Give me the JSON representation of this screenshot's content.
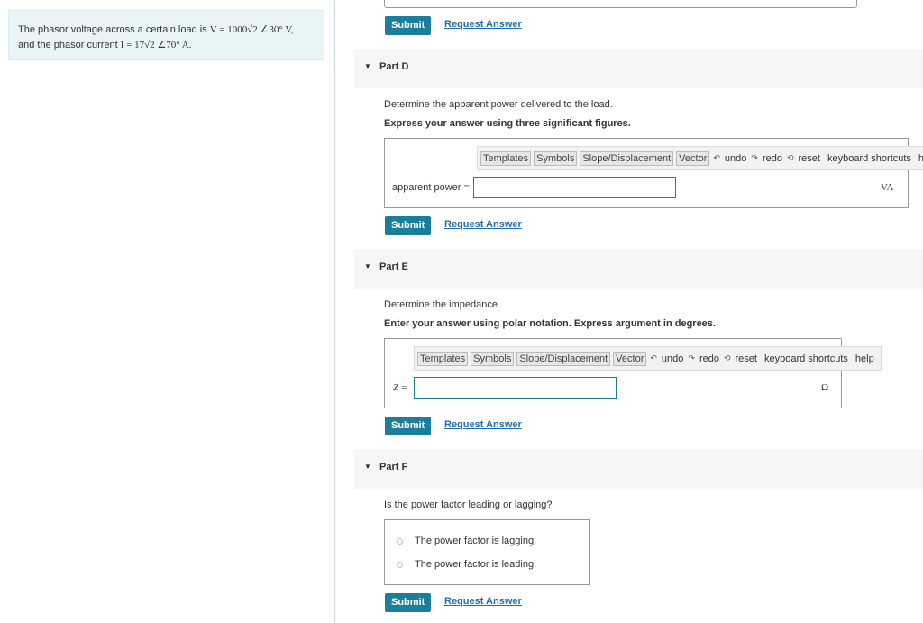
{
  "problem": {
    "line1_prefix": "The phasor voltage across a certain load is",
    "line1_math": "V = 1000√2 ∠30° V,",
    "line2_prefix": "and the phasor current",
    "line2_math": "I = 17√2 ∠70° A."
  },
  "common": {
    "submit_label": "Submit",
    "request_label": "Request Answer"
  },
  "toolbar": {
    "templates": "Templates",
    "symbols": "Symbols",
    "slope": "Slope/Displacement",
    "vector": "Vector",
    "undo": "undo",
    "redo": "redo",
    "reset": "reset",
    "shortcuts": "keyboard shortcuts",
    "help": "help"
  },
  "partD": {
    "title": "Part D",
    "prompt": "Determine the apparent power delivered to the load.",
    "instruction": "Express your answer using three significant figures.",
    "label": "apparent power =",
    "unit": "VA",
    "value": ""
  },
  "partE": {
    "title": "Part E",
    "prompt": "Determine the impedance.",
    "instruction": "Enter your answer using polar notation. Express argument in degrees.",
    "label": "Z =",
    "unit": "Ω",
    "value": ""
  },
  "partF": {
    "title": "Part F",
    "prompt": "Is the power factor leading or lagging?",
    "options": [
      "The power factor is lagging.",
      "The power factor is leading."
    ]
  }
}
